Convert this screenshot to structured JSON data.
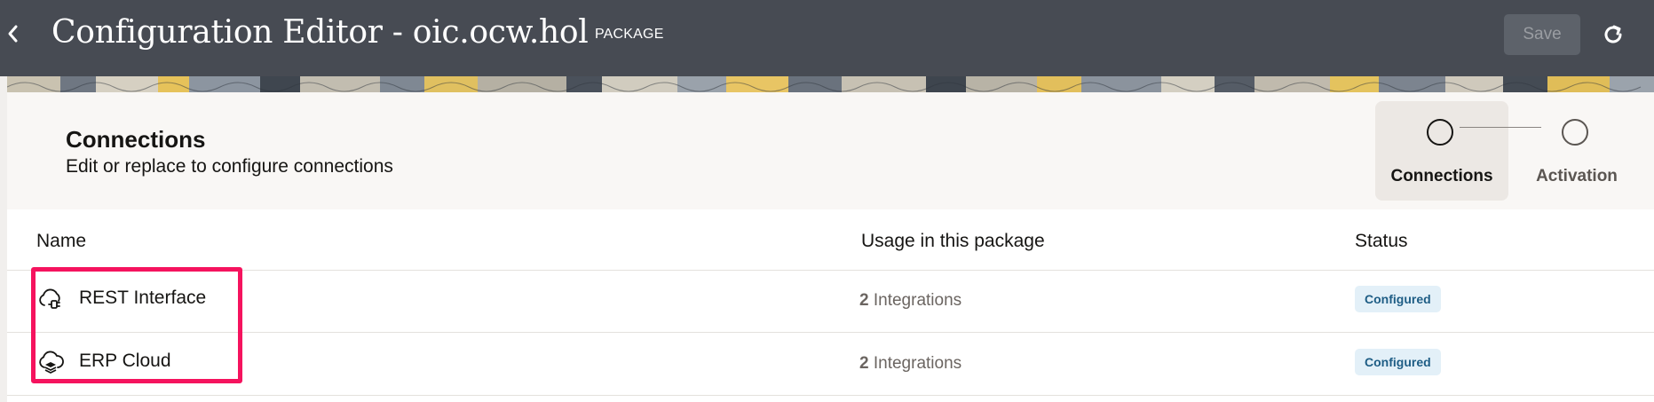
{
  "header": {
    "title": "Configuration Editor - oic.ocw.hol",
    "type_badge": "PACKAGE",
    "save_label": "Save",
    "back_icon": "chevron-left-icon",
    "refresh_icon": "refresh-icon",
    "background_color": "#474b53"
  },
  "section": {
    "title": "Connections",
    "subtitle": "Edit or replace to configure connections"
  },
  "train": {
    "steps": [
      {
        "label": "Connections",
        "active": true
      },
      {
        "label": "Activation",
        "active": false
      }
    ]
  },
  "table": {
    "columns": [
      "Name",
      "Usage in this package",
      "Status"
    ],
    "rows": [
      {
        "name": "REST Interface",
        "icon": "cloud-plug-icon",
        "usage_count": "2",
        "usage_label": "Integrations",
        "status": "Configured"
      },
      {
        "name": "ERP Cloud",
        "icon": "cloud-stack-icon",
        "usage_count": "2",
        "usage_label": "Integrations",
        "status": "Configured"
      }
    ]
  },
  "colors": {
    "highlight": "#f5135e",
    "status_bg": "#e3f0f8",
    "status_text": "#1e5d85"
  }
}
